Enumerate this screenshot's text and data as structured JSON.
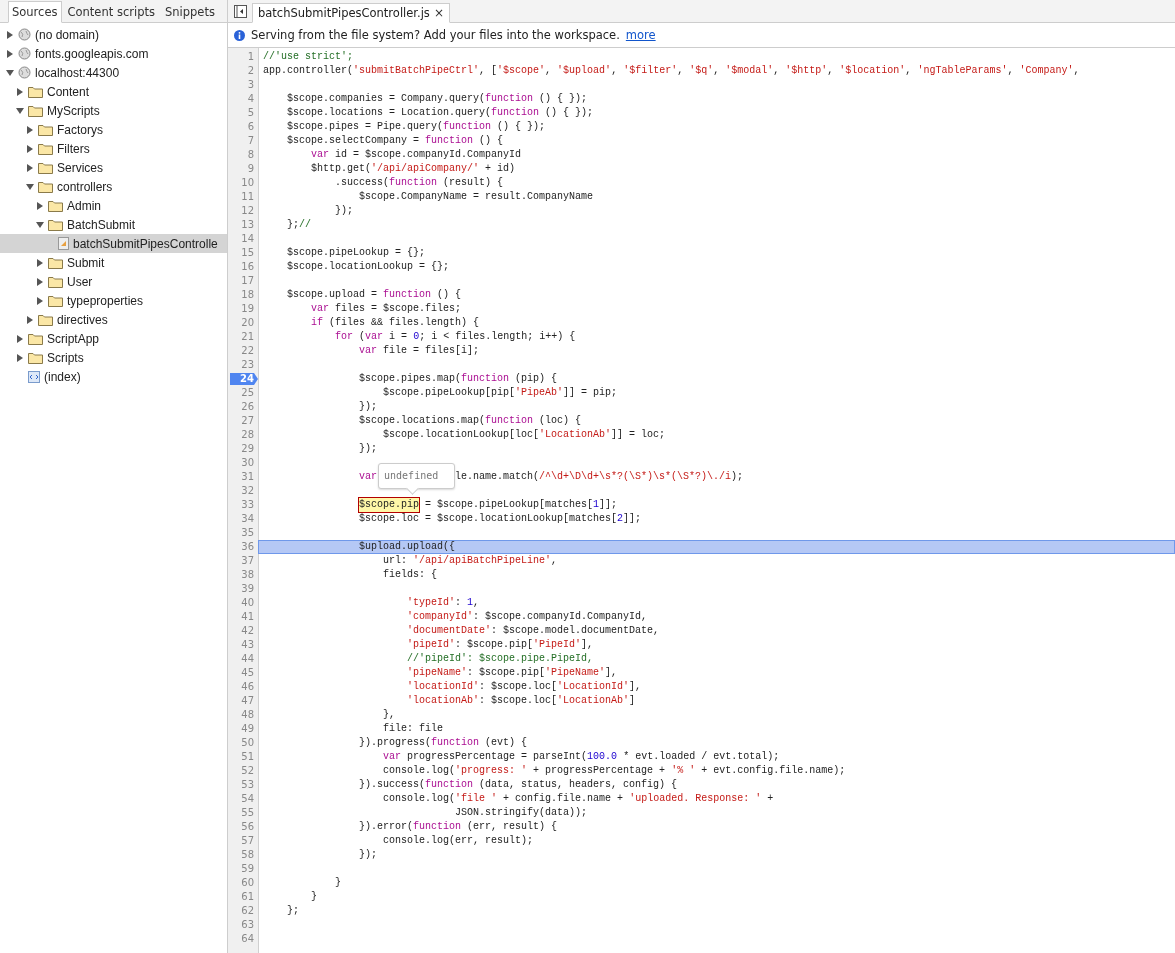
{
  "navigator": {
    "tabs": [
      {
        "label": "Sources",
        "selected": true
      },
      {
        "label": "Content scripts",
        "selected": false
      },
      {
        "label": "Snippets",
        "selected": false
      }
    ],
    "tree": [
      {
        "label": "(no domain)",
        "kind": "domain",
        "expanded": false,
        "selected": false
      },
      {
        "label": "fonts.googleapis.com",
        "kind": "domain",
        "expanded": false,
        "selected": false
      },
      {
        "label": "localhost:44300",
        "kind": "domain",
        "expanded": true,
        "selected": false,
        "children": [
          {
            "label": "Content",
            "kind": "folder",
            "expanded": false,
            "selected": false
          },
          {
            "label": "MyScripts",
            "kind": "folder",
            "expanded": true,
            "selected": false,
            "children": [
              {
                "label": "Factorys",
                "kind": "folder",
                "expanded": false,
                "selected": false
              },
              {
                "label": "Filters",
                "kind": "folder",
                "expanded": false,
                "selected": false
              },
              {
                "label": "Services",
                "kind": "folder",
                "expanded": false,
                "selected": false
              },
              {
                "label": "controllers",
                "kind": "folder",
                "expanded": true,
                "selected": false,
                "children": [
                  {
                    "label": "Admin",
                    "kind": "folder",
                    "expanded": false,
                    "selected": false
                  },
                  {
                    "label": "BatchSubmit",
                    "kind": "folder",
                    "expanded": true,
                    "selected": false,
                    "children": [
                      {
                        "label": "batchSubmitPipesControlle",
                        "kind": "script",
                        "selected": true
                      }
                    ]
                  },
                  {
                    "label": "Submit",
                    "kind": "folder",
                    "expanded": false,
                    "selected": false
                  },
                  {
                    "label": "User",
                    "kind": "folder",
                    "expanded": false,
                    "selected": false
                  },
                  {
                    "label": "typeproperties",
                    "kind": "folder",
                    "expanded": false,
                    "selected": false
                  }
                ]
              },
              {
                "label": "directives",
                "kind": "folder",
                "expanded": false,
                "selected": false
              }
            ]
          },
          {
            "label": "ScriptApp",
            "kind": "folder",
            "expanded": false,
            "selected": false
          },
          {
            "label": "Scripts",
            "kind": "folder",
            "expanded": false,
            "selected": false
          },
          {
            "label": "(index)",
            "kind": "page",
            "selected": false
          }
        ]
      }
    ]
  },
  "editor": {
    "tabs": [
      {
        "label": "batchSubmitPipesController.js",
        "close": "×",
        "selected": true
      }
    ],
    "infobar": {
      "text": "Serving from the file system? Add your files into the workspace.",
      "link": "more"
    },
    "popover": "undefined",
    "lines": [
      {
        "n": "1",
        "breakpoint": false,
        "current": false,
        "tokens": [
          {
            "t": "//'use strict';",
            "kind": "comment"
          }
        ]
      },
      {
        "n": "2",
        "breakpoint": false,
        "current": false,
        "tokens": [
          {
            "t": "app.controller(",
            "kind": "plain"
          },
          {
            "t": "'submitBatchPipeCtrl'",
            "kind": "string"
          },
          {
            "t": ", [",
            "kind": "plain"
          },
          {
            "t": "'$scope'",
            "kind": "string"
          },
          {
            "t": ",",
            "kind": "plain"
          },
          {
            "t": " '$upload'",
            "kind": "string"
          },
          {
            "t": ",",
            "kind": "plain"
          },
          {
            "t": " '$filter'",
            "kind": "string"
          },
          {
            "t": ",",
            "kind": "plain"
          },
          {
            "t": " '$q'",
            "kind": "string"
          },
          {
            "t": ",",
            "kind": "plain"
          },
          {
            "t": " '$modal'",
            "kind": "string"
          },
          {
            "t": ",",
            "kind": "plain"
          },
          {
            "t": " '$http'",
            "kind": "string"
          },
          {
            "t": ",",
            "kind": "plain"
          },
          {
            "t": " '$location'",
            "kind": "string"
          },
          {
            "t": ",",
            "kind": "plain"
          },
          {
            "t": " 'ngTableParams'",
            "kind": "string"
          },
          {
            "t": ",",
            "kind": "plain"
          },
          {
            "t": " 'Company'",
            "kind": "string"
          },
          {
            "t": ",",
            "kind": "plain"
          }
        ]
      },
      {
        "n": "3",
        "breakpoint": false,
        "current": false
      },
      {
        "n": "4",
        "breakpoint": false,
        "current": false,
        "tokens": [
          {
            "t": "    $scope.companies = Company.query(",
            "kind": "plain"
          },
          {
            "t": "function",
            "kind": "keyword"
          },
          {
            "t": " () { });",
            "kind": "plain"
          }
        ]
      },
      {
        "n": "5",
        "breakpoint": false,
        "current": false,
        "tokens": [
          {
            "t": "    $scope.locations = Location.query(",
            "kind": "plain"
          },
          {
            "t": "function",
            "kind": "keyword"
          },
          {
            "t": " () { });",
            "kind": "plain"
          }
        ]
      },
      {
        "n": "6",
        "breakpoint": false,
        "current": false,
        "tokens": [
          {
            "t": "    $scope.pipes = Pipe.query(",
            "kind": "plain"
          },
          {
            "t": "function",
            "kind": "keyword"
          },
          {
            "t": " () { });",
            "kind": "plain"
          }
        ]
      },
      {
        "n": "7",
        "breakpoint": false,
        "current": false,
        "tokens": [
          {
            "t": "    $scope.selectCompany = ",
            "kind": "plain"
          },
          {
            "t": "function",
            "kind": "keyword"
          },
          {
            "t": " () {",
            "kind": "plain"
          }
        ]
      },
      {
        "n": "8",
        "breakpoint": false,
        "current": false,
        "tokens": [
          {
            "t": "        var",
            "kind": "keyword"
          },
          {
            "t": " id = $scope.companyId.CompanyId",
            "kind": "plain"
          }
        ]
      },
      {
        "n": "9",
        "breakpoint": false,
        "current": false,
        "tokens": [
          {
            "t": "        $http.get(",
            "kind": "plain"
          },
          {
            "t": "'/api/apiCompany/'",
            "kind": "string"
          },
          {
            "t": " + id)",
            "kind": "plain"
          }
        ]
      },
      {
        "n": "10",
        "breakpoint": false,
        "current": false,
        "tokens": [
          {
            "t": "            .success(",
            "kind": "plain"
          },
          {
            "t": "function",
            "kind": "keyword"
          },
          {
            "t": " (result) {",
            "kind": "plain"
          }
        ]
      },
      {
        "n": "11",
        "breakpoint": false,
        "current": false,
        "tokens": [
          {
            "t": "                $scope.CompanyName = result.CompanyName",
            "kind": "plain"
          }
        ]
      },
      {
        "n": "12",
        "breakpoint": false,
        "current": false,
        "tokens": [
          {
            "t": "            });",
            "kind": "plain"
          }
        ]
      },
      {
        "n": "13",
        "breakpoint": false,
        "current": false,
        "tokens": [
          {
            "t": "    };",
            "kind": "plain"
          },
          {
            "t": "//",
            "kind": "comment"
          }
        ]
      },
      {
        "n": "14",
        "breakpoint": false,
        "current": false
      },
      {
        "n": "15",
        "breakpoint": false,
        "current": false,
        "tokens": [
          {
            "t": "    $scope.pipeLookup = {};",
            "kind": "plain"
          }
        ]
      },
      {
        "n": "16",
        "breakpoint": false,
        "current": false,
        "tokens": [
          {
            "t": "    $scope.locationLookup = {};",
            "kind": "plain"
          }
        ]
      },
      {
        "n": "17",
        "breakpoint": false,
        "current": false
      },
      {
        "n": "18",
        "breakpoint": false,
        "current": false,
        "tokens": [
          {
            "t": "    $scope.upload = ",
            "kind": "plain"
          },
          {
            "t": "function",
            "kind": "keyword"
          },
          {
            "t": " () {",
            "kind": "plain"
          }
        ]
      },
      {
        "n": "19",
        "breakpoint": false,
        "current": false,
        "tokens": [
          {
            "t": "        var",
            "kind": "keyword"
          },
          {
            "t": " files = $scope.files;",
            "kind": "plain"
          }
        ]
      },
      {
        "n": "20",
        "breakpoint": false,
        "current": false,
        "tokens": [
          {
            "t": "        if",
            "kind": "keyword"
          },
          {
            "t": " (files && files.length) {",
            "kind": "plain"
          }
        ]
      },
      {
        "n": "21",
        "breakpoint": false,
        "current": false,
        "tokens": [
          {
            "t": "            for",
            "kind": "keyword"
          },
          {
            "t": " (",
            "kind": "plain"
          },
          {
            "t": "var",
            "kind": "keyword"
          },
          {
            "t": " i =",
            "kind": "plain"
          },
          {
            "t": " 0",
            "kind": "number"
          },
          {
            "t": "; i < files.length; i++) {",
            "kind": "plain"
          }
        ]
      },
      {
        "n": "22",
        "breakpoint": false,
        "current": false,
        "tokens": [
          {
            "t": "                var",
            "kind": "keyword"
          },
          {
            "t": " file = files[i];",
            "kind": "plain"
          }
        ]
      },
      {
        "n": "23",
        "breakpoint": false,
        "current": false
      },
      {
        "n": "24",
        "breakpoint": true,
        "current": false,
        "tokens": [
          {
            "t": "                $scope.pipes.map(",
            "kind": "plain"
          },
          {
            "t": "function",
            "kind": "keyword"
          },
          {
            "t": " (pip) {",
            "kind": "plain"
          }
        ]
      },
      {
        "n": "25",
        "breakpoint": false,
        "current": false,
        "tokens": [
          {
            "t": "                    $scope.pipeLookup[pip[",
            "kind": "plain"
          },
          {
            "t": "'PipeAb'",
            "kind": "string"
          },
          {
            "t": "]] = pip;",
            "kind": "plain"
          }
        ]
      },
      {
        "n": "26",
        "breakpoint": false,
        "current": false,
        "tokens": [
          {
            "t": "                });",
            "kind": "plain"
          }
        ]
      },
      {
        "n": "27",
        "breakpoint": false,
        "current": false,
        "tokens": [
          {
            "t": "                $scope.locations.map(",
            "kind": "plain"
          },
          {
            "t": "function",
            "kind": "keyword"
          },
          {
            "t": " (loc) {",
            "kind": "plain"
          }
        ]
      },
      {
        "n": "28",
        "breakpoint": false,
        "current": false,
        "tokens": [
          {
            "t": "                    $scope.locationLookup[loc[",
            "kind": "plain"
          },
          {
            "t": "'LocationAb'",
            "kind": "string"
          },
          {
            "t": "]] = loc;",
            "kind": "plain"
          }
        ]
      },
      {
        "n": "29",
        "breakpoint": false,
        "current": false,
        "tokens": [
          {
            "t": "                });",
            "kind": "plain"
          }
        ]
      },
      {
        "n": "30",
        "breakpoint": false,
        "current": false
      },
      {
        "n": "31",
        "breakpoint": false,
        "current": false,
        "tokens": [
          {
            "t": "                var",
            "kind": "keyword"
          },
          {
            "kind": "popover"
          },
          {
            "t": "le.name.match(",
            "kind": "plain"
          },
          {
            "t": "/^\\d+\\D\\d+\\s*?(\\S*)\\s*(\\S*?)\\./i",
            "kind": "string"
          },
          {
            "t": ");",
            "kind": "plain"
          }
        ]
      },
      {
        "n": "32",
        "breakpoint": false,
        "current": false
      },
      {
        "n": "33",
        "breakpoint": false,
        "current": false,
        "tokens": [
          {
            "t": "                $scope.pip",
            "kind": "hover"
          },
          {
            "t": " = $scope.pipeLookup[matches[",
            "kind": "plain"
          },
          {
            "t": "1",
            "kind": "number"
          },
          {
            "t": "]];",
            "kind": "plain"
          }
        ]
      },
      {
        "n": "34",
        "breakpoint": false,
        "current": false,
        "tokens": [
          {
            "t": "                $scope.loc = $scope.locationLookup[matches[",
            "kind": "plain"
          },
          {
            "t": "2",
            "kind": "number"
          },
          {
            "t": "]];",
            "kind": "plain"
          }
        ]
      },
      {
        "n": "35",
        "breakpoint": false,
        "current": false
      },
      {
        "n": "36",
        "breakpoint": false,
        "current": true,
        "tokens": [
          {
            "t": "                $upload.upload({",
            "kind": "plain"
          }
        ]
      },
      {
        "n": "37",
        "breakpoint": false,
        "current": false,
        "tokens": [
          {
            "t": "                    url: ",
            "kind": "plain"
          },
          {
            "t": "'/api/apiBatchPipeLine'",
            "kind": "string"
          },
          {
            "t": ",",
            "kind": "plain"
          }
        ]
      },
      {
        "n": "38",
        "breakpoint": false,
        "current": false,
        "tokens": [
          {
            "t": "                    fields: {",
            "kind": "plain"
          }
        ]
      },
      {
        "n": "39",
        "breakpoint": false,
        "current": false
      },
      {
        "n": "40",
        "breakpoint": false,
        "current": false,
        "tokens": [
          {
            "t": "                        'typeId'",
            "kind": "string"
          },
          {
            "t": ": ",
            "kind": "plain"
          },
          {
            "t": "1",
            "kind": "number"
          },
          {
            "t": ",",
            "kind": "plain"
          }
        ]
      },
      {
        "n": "41",
        "breakpoint": false,
        "current": false,
        "tokens": [
          {
            "t": "                        'companyId'",
            "kind": "string"
          },
          {
            "t": ": $scope.companyId.CompanyId,",
            "kind": "plain"
          }
        ]
      },
      {
        "n": "42",
        "breakpoint": false,
        "current": false,
        "tokens": [
          {
            "t": "                        'documentDate'",
            "kind": "string"
          },
          {
            "t": ": $scope.model.documentDate,",
            "kind": "plain"
          }
        ]
      },
      {
        "n": "43",
        "breakpoint": false,
        "current": false,
        "tokens": [
          {
            "t": "                        'pipeId'",
            "kind": "string"
          },
          {
            "t": ": $scope.pip[",
            "kind": "plain"
          },
          {
            "t": "'PipeId'",
            "kind": "string"
          },
          {
            "t": "],",
            "kind": "plain"
          }
        ]
      },
      {
        "n": "44",
        "breakpoint": false,
        "current": false,
        "tokens": [
          {
            "t": "                        //'pipeId': $scope.pipe.PipeId,",
            "kind": "comment"
          }
        ]
      },
      {
        "n": "45",
        "breakpoint": false,
        "current": false,
        "tokens": [
          {
            "t": "                        'pipeName'",
            "kind": "string"
          },
          {
            "t": ": $scope.pip[",
            "kind": "plain"
          },
          {
            "t": "'PipeName'",
            "kind": "string"
          },
          {
            "t": "],",
            "kind": "plain"
          }
        ]
      },
      {
        "n": "46",
        "breakpoint": false,
        "current": false,
        "tokens": [
          {
            "t": "                        'locationId'",
            "kind": "string"
          },
          {
            "t": ": $scope.loc[",
            "kind": "plain"
          },
          {
            "t": "'LocationId'",
            "kind": "string"
          },
          {
            "t": "],",
            "kind": "plain"
          }
        ]
      },
      {
        "n": "47",
        "breakpoint": false,
        "current": false,
        "tokens": [
          {
            "t": "                        'locationAb'",
            "kind": "string"
          },
          {
            "t": ": $scope.loc[",
            "kind": "plain"
          },
          {
            "t": "'LocationAb'",
            "kind": "string"
          },
          {
            "t": "]",
            "kind": "plain"
          }
        ]
      },
      {
        "n": "48",
        "breakpoint": false,
        "current": false,
        "tokens": [
          {
            "t": "                    },",
            "kind": "plain"
          }
        ]
      },
      {
        "n": "49",
        "breakpoint": false,
        "current": false,
        "tokens": [
          {
            "t": "                    file: file",
            "kind": "plain"
          }
        ]
      },
      {
        "n": "50",
        "breakpoint": false,
        "current": false,
        "tokens": [
          {
            "t": "                }).progress(",
            "kind": "plain"
          },
          {
            "t": "function",
            "kind": "keyword"
          },
          {
            "t": " (evt) {",
            "kind": "plain"
          }
        ]
      },
      {
        "n": "51",
        "breakpoint": false,
        "current": false,
        "tokens": [
          {
            "t": "                    var",
            "kind": "keyword"
          },
          {
            "t": " progressPercentage = parseInt(",
            "kind": "plain"
          },
          {
            "t": "100.0",
            "kind": "number"
          },
          {
            "t": " * evt.loaded / evt.total);",
            "kind": "plain"
          }
        ]
      },
      {
        "n": "52",
        "breakpoint": false,
        "current": false,
        "tokens": [
          {
            "t": "                    console.log(",
            "kind": "plain"
          },
          {
            "t": "'progress: '",
            "kind": "string"
          },
          {
            "t": " + progressPercentage +",
            "kind": "plain"
          },
          {
            "t": " '% '",
            "kind": "string"
          },
          {
            "t": " + evt.config.file.name);",
            "kind": "plain"
          }
        ]
      },
      {
        "n": "53",
        "breakpoint": false,
        "current": false,
        "tokens": [
          {
            "t": "                }).success(",
            "kind": "plain"
          },
          {
            "t": "function",
            "kind": "keyword"
          },
          {
            "t": " (data, status, headers, config) {",
            "kind": "plain"
          }
        ]
      },
      {
        "n": "54",
        "breakpoint": false,
        "current": false,
        "tokens": [
          {
            "t": "                    console.log(",
            "kind": "plain"
          },
          {
            "t": "'file '",
            "kind": "string"
          },
          {
            "t": " + config.file.name +",
            "kind": "plain"
          },
          {
            "t": " 'uploaded. Response: '",
            "kind": "string"
          },
          {
            "t": " +",
            "kind": "plain"
          }
        ]
      },
      {
        "n": "55",
        "breakpoint": false,
        "current": false,
        "tokens": [
          {
            "t": "                                JSON.stringify(data));",
            "kind": "plain"
          }
        ]
      },
      {
        "n": "56",
        "breakpoint": false,
        "current": false,
        "tokens": [
          {
            "t": "                }).error(",
            "kind": "plain"
          },
          {
            "t": "function",
            "kind": "keyword"
          },
          {
            "t": " (err, result) {",
            "kind": "plain"
          }
        ]
      },
      {
        "n": "57",
        "breakpoint": false,
        "current": false,
        "tokens": [
          {
            "t": "                    console.log(err, result);",
            "kind": "plain"
          }
        ]
      },
      {
        "n": "58",
        "breakpoint": false,
        "current": false,
        "tokens": [
          {
            "t": "                });",
            "kind": "plain"
          }
        ]
      },
      {
        "n": "59",
        "breakpoint": false,
        "current": false
      },
      {
        "n": "60",
        "breakpoint": false,
        "current": false,
        "tokens": [
          {
            "t": "            }",
            "kind": "plain"
          }
        ]
      },
      {
        "n": "61",
        "breakpoint": false,
        "current": false,
        "tokens": [
          {
            "t": "        }",
            "kind": "plain"
          }
        ]
      },
      {
        "n": "62",
        "breakpoint": false,
        "current": false,
        "tokens": [
          {
            "t": "    };",
            "kind": "plain"
          }
        ]
      },
      {
        "n": "63",
        "breakpoint": false,
        "current": false
      },
      {
        "n": "64",
        "breakpoint": false,
        "current": false
      }
    ]
  }
}
